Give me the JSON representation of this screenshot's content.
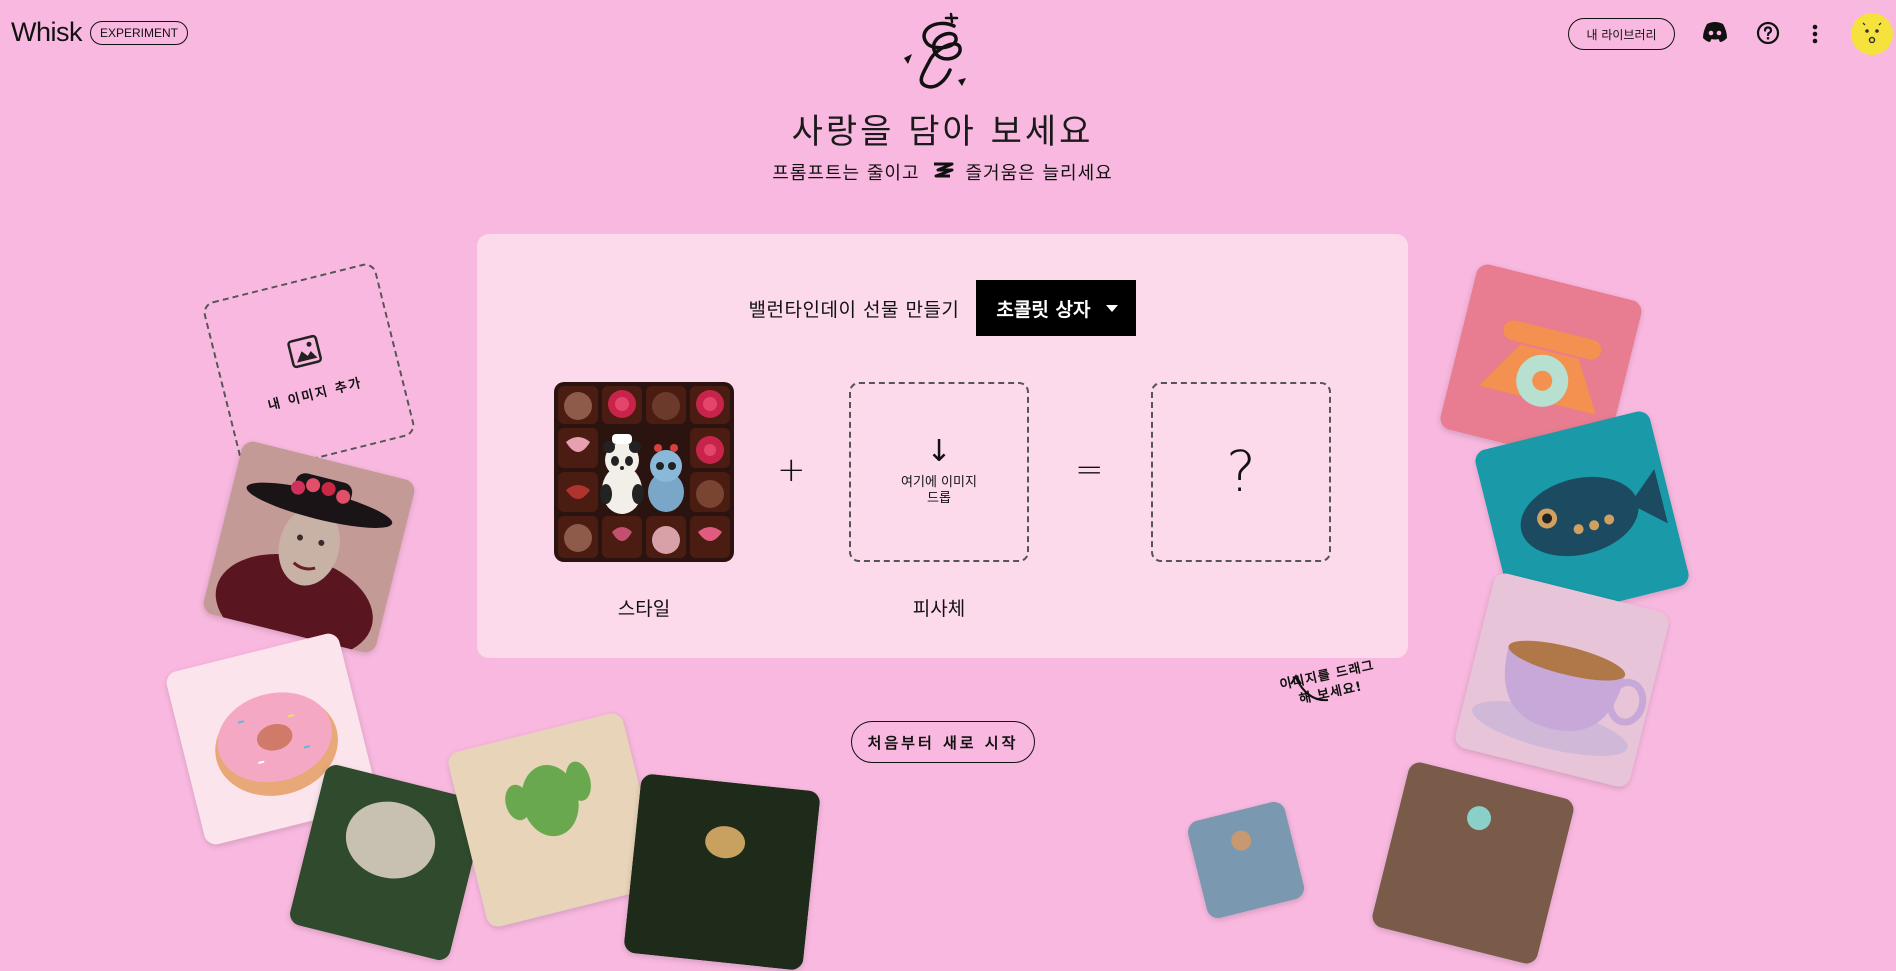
{
  "header": {
    "brand": "Whisk",
    "badge": "EXPERIMENT",
    "library_label": "내 라이브러리"
  },
  "icons": {
    "discord": "discord-icon",
    "help": "help-icon",
    "more": "more-vertical-icon",
    "avatar": "avatar"
  },
  "hero": {
    "title": "사랑을 담아 보세요",
    "subtitle_left": "프롬프트는 줄이고",
    "subtitle_right": "즐거움은 늘리세요"
  },
  "panel": {
    "prompt_label": "밸런타인데이 선물 만들기",
    "dropdown_value": "초콜릿 상자",
    "plus": "+",
    "equals": "=",
    "arrow": "↓",
    "drop_text_line1": "여기에 이미지",
    "drop_text_line2": "드롭",
    "result_placeholder": "?",
    "style_label": "스타일",
    "subject_label": "피사체"
  },
  "gallery": {
    "add_image_label": "내 이미지 추가",
    "drag_hint_line1": "이미지를 드래그",
    "drag_hint_line2": "해 보세요!"
  },
  "actions": {
    "restart_label": "처음부터 새로 시작"
  },
  "colors": {
    "background": "#f8b8df",
    "panel": "#fdd9ec",
    "avatar": "#f6e23d",
    "dropdown": "#000000"
  }
}
